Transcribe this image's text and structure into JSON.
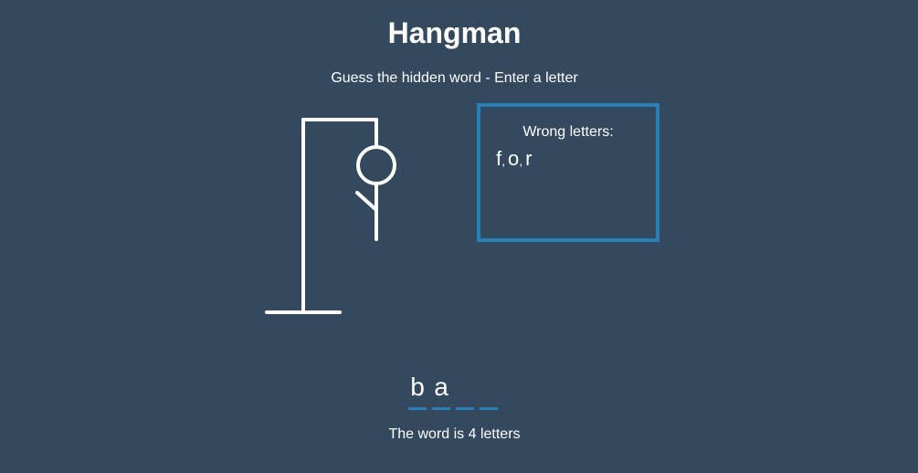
{
  "game": {
    "title": "Hangman",
    "subtitle": "Guess the hidden word - Enter a letter"
  },
  "wrong_letters": {
    "label": "Wrong letters:",
    "letters": [
      "f",
      "o",
      "r"
    ],
    "separator": ","
  },
  "word": {
    "slots": [
      "b",
      "a",
      "",
      ""
    ],
    "info": "The word is 4 letters"
  },
  "figure": {
    "parts_revealed": [
      "head",
      "body",
      "left-arm"
    ]
  },
  "colors": {
    "background": "#34495e",
    "accent": "#2980b9",
    "text": "#ffffff"
  }
}
